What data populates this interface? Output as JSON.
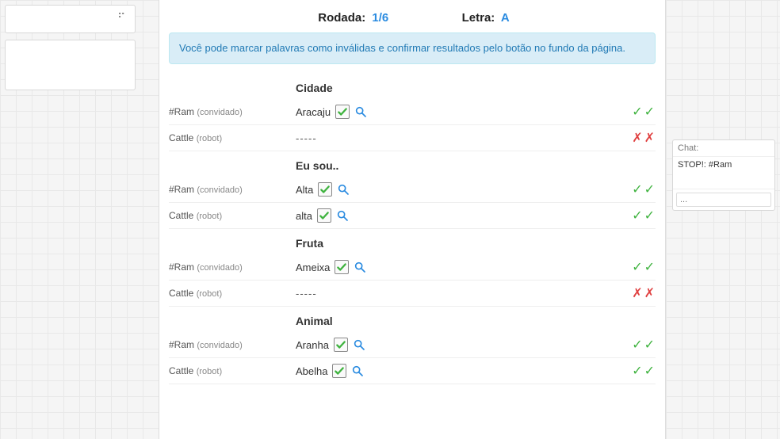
{
  "header": {
    "round_label": "Rodada:",
    "round_value": "1/6",
    "letter_label": "Letra:",
    "letter_value": "A"
  },
  "info_message": "Você pode marcar palavras como inválidas e confirmar resultados pelo botão no fundo da página.",
  "players": {
    "p1_name": "#Ram",
    "p1_role": "(convidado)",
    "p2_name": "Cattle",
    "p2_role": "(robot)"
  },
  "categories": [
    {
      "title": "Cidade",
      "rows": [
        {
          "player": "p1",
          "word": "Aracaju",
          "checked": true,
          "has_search": true,
          "votes": [
            "g",
            "g"
          ]
        },
        {
          "player": "p2",
          "word": "-----",
          "checked": false,
          "has_search": false,
          "votes": [
            "r",
            "r"
          ]
        }
      ]
    },
    {
      "title": "Eu sou..",
      "rows": [
        {
          "player": "p1",
          "word": "Alta",
          "checked": true,
          "has_search": true,
          "votes": [
            "g",
            "g"
          ]
        },
        {
          "player": "p2",
          "word": "alta",
          "checked": true,
          "has_search": true,
          "votes": [
            "g",
            "g"
          ]
        }
      ]
    },
    {
      "title": "Fruta",
      "rows": [
        {
          "player": "p1",
          "word": "Ameixa",
          "checked": true,
          "has_search": true,
          "votes": [
            "g",
            "g"
          ]
        },
        {
          "player": "p2",
          "word": "-----",
          "checked": false,
          "has_search": false,
          "votes": [
            "r",
            "r"
          ]
        }
      ]
    },
    {
      "title": "Animal",
      "rows": [
        {
          "player": "p1",
          "word": "Aranha",
          "checked": true,
          "has_search": true,
          "votes": [
            "g",
            "g"
          ]
        },
        {
          "player": "p2",
          "word": "Abelha",
          "checked": true,
          "has_search": true,
          "votes": [
            "g",
            "g"
          ]
        }
      ]
    }
  ],
  "chat": {
    "title": "Chat:",
    "messages": [
      {
        "text": "STOP!: #Ram"
      }
    ],
    "input_placeholder": "..."
  },
  "icons": {
    "check": "check-icon",
    "search": "search-icon"
  }
}
